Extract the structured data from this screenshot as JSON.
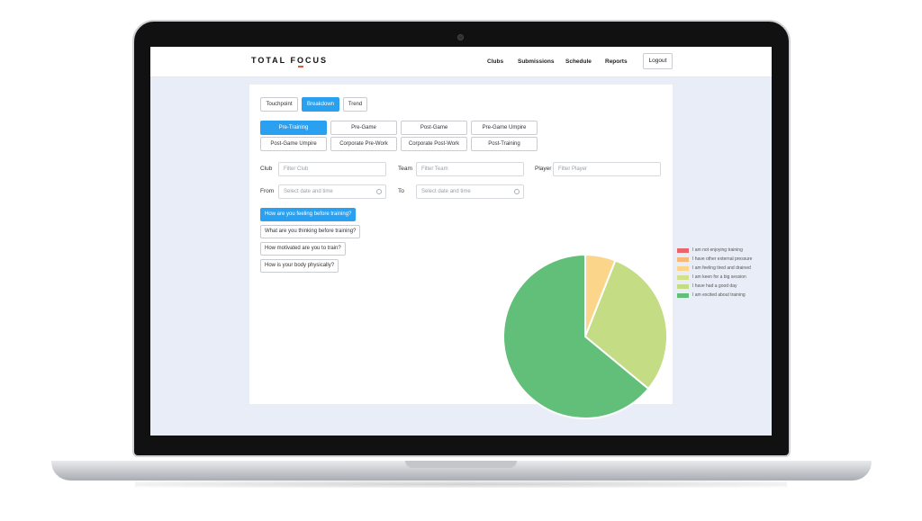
{
  "nav": {
    "logo": "TOTAL FOCUS",
    "links": [
      "Clubs",
      "Submissions",
      "Schedule",
      "Reports"
    ],
    "logout": "Logout"
  },
  "view_tabs": [
    "Touchpoint",
    "Breakdown",
    "Trend"
  ],
  "active_view": "Breakdown",
  "category_buttons": [
    "Pre-Training",
    "Pre-Game",
    "Post-Game",
    "Pre-Game Umpire",
    "Post-Game Umpire",
    "Corporate Pre-Work",
    "Corporate Post-Work",
    "Post-Training"
  ],
  "active_category": "Pre-Training",
  "filters": {
    "club_label": "Club",
    "club_placeholder": "Filter Club",
    "team_label": "Team",
    "team_placeholder": "Filter Team",
    "player_label": "Player",
    "player_placeholder": "Filter Player",
    "from_label": "From",
    "from_placeholder": "Select date and time",
    "to_label": "To",
    "to_placeholder": "Select date and time"
  },
  "questions": [
    "How are you feeling before training?",
    "What are you thinking before training?",
    "How motivated are you to train?",
    "How is your body physically?"
  ],
  "active_question": "How are you feeling before training?",
  "chart_data": {
    "type": "pie",
    "categories": [
      "I am not enjoying training",
      "I have other external pressure",
      "I am feeling tired and drained",
      "I am keen for a big session",
      "I have had a good day",
      "I am excited about training"
    ],
    "values": [
      0,
      0,
      6,
      0,
      30,
      64
    ],
    "colors": [
      "#e8666a",
      "#f7b97a",
      "#fbd68a",
      "#d4e08a",
      "#c4dc84",
      "#62bf79"
    ],
    "legend_position": "right"
  }
}
